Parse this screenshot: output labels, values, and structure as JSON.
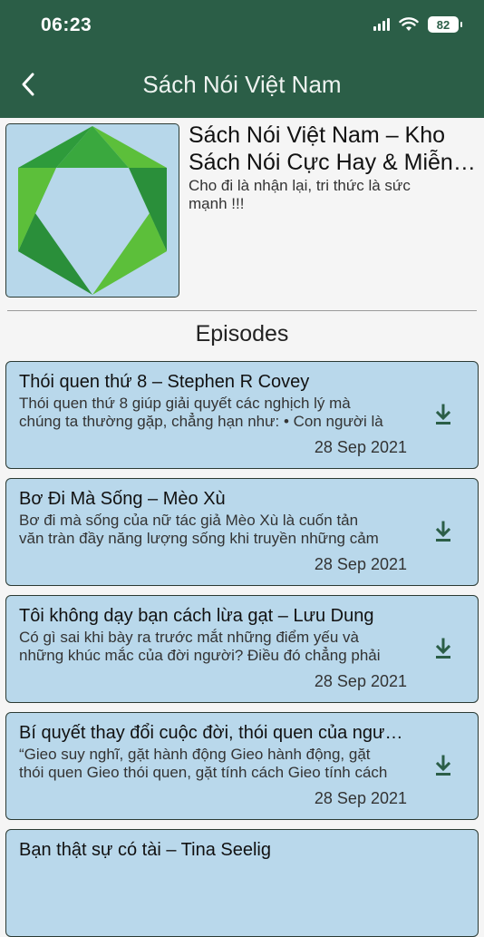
{
  "status_bar": {
    "time": "06:23",
    "battery": "82"
  },
  "header": {
    "title": "Sách Nói Việt Nam"
  },
  "podcast": {
    "title_line1": "Sách Nói Việt Nam – Kho",
    "title_line2": "Sách Nói Cực Hay & Miễn Phí",
    "subtitle": "Cho đi là nhận lại, tri thức là sức mạnh !!!"
  },
  "section": {
    "title": "Episodes"
  },
  "episodes": [
    {
      "title": "Thói quen thứ 8 – Stephen R Covey",
      "desc1": "Thói quen thứ 8 giúp giải quyết các nghịch lý mà",
      "desc2": "chúng ta thường gặp, chẳng hạn như: • Con người là",
      "date": "28 Sep 2021"
    },
    {
      "title": "Bơ Đi Mà Sống – Mèo Xù",
      "desc1": "Bơ đi mà sống của nữ tác giả Mèo Xù là cuốn tản",
      "desc2": "văn tràn đầy năng lượng sống khi truyền những cảm",
      "date": "28 Sep 2021"
    },
    {
      "title": "Tôi không dạy bạn cách lừa gạt – Lưu Dung",
      "desc1": "Có gì sai khi bày ra trước mắt những điểm yếu và",
      "desc2": "những khúc mắc của đời người? Điều đó chẳng phải",
      "date": "28 Sep 2021"
    },
    {
      "title": "Bí quyết thay đổi cuộc đời, thói quen của người thành công",
      "desc1": "“Gieo suy nghĩ, gặt hành động Gieo hành động, gặt",
      "desc2": "thói quen Gieo thói quen, gặt tính cách Gieo tính cách",
      "date": "28 Sep 2021"
    },
    {
      "title": "Bạn thật sự có tài – Tina Seelig",
      "desc1": "",
      "desc2": "",
      "date": ""
    }
  ],
  "colors": {
    "header": "#2b5e47",
    "card": "#b9d8eb",
    "accent": "#2b5e47"
  },
  "icons": {
    "back": "chevron-left-icon",
    "download": "download-icon"
  }
}
